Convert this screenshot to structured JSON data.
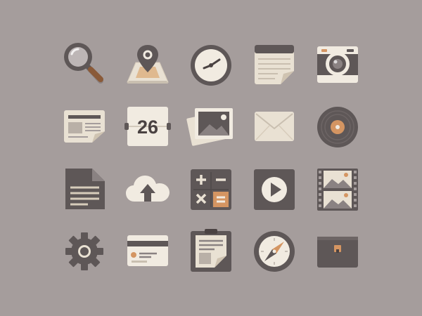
{
  "colors": {
    "background": "#a59d9c",
    "dark": "#5e5757",
    "cream": "#f1ebe1",
    "paper": "#e9e1d3",
    "accent": "#d49562",
    "text_dark": "#4a4242"
  },
  "icons": [
    {
      "name": "magnifier-icon"
    },
    {
      "name": "map-pin-icon"
    },
    {
      "name": "clock-icon"
    },
    {
      "name": "notepad-icon"
    },
    {
      "name": "camera-icon"
    },
    {
      "name": "newspaper-icon"
    },
    {
      "name": "calendar-icon",
      "label": "26"
    },
    {
      "name": "photos-icon"
    },
    {
      "name": "envelope-icon"
    },
    {
      "name": "vinyl-record-icon"
    },
    {
      "name": "document-icon"
    },
    {
      "name": "cloud-upload-icon"
    },
    {
      "name": "calculator-icon"
    },
    {
      "name": "play-button-icon"
    },
    {
      "name": "film-strip-icon"
    },
    {
      "name": "settings-gear-icon"
    },
    {
      "name": "credit-card-icon"
    },
    {
      "name": "clipboard-icon"
    },
    {
      "name": "compass-icon"
    },
    {
      "name": "briefcase-icon"
    }
  ]
}
